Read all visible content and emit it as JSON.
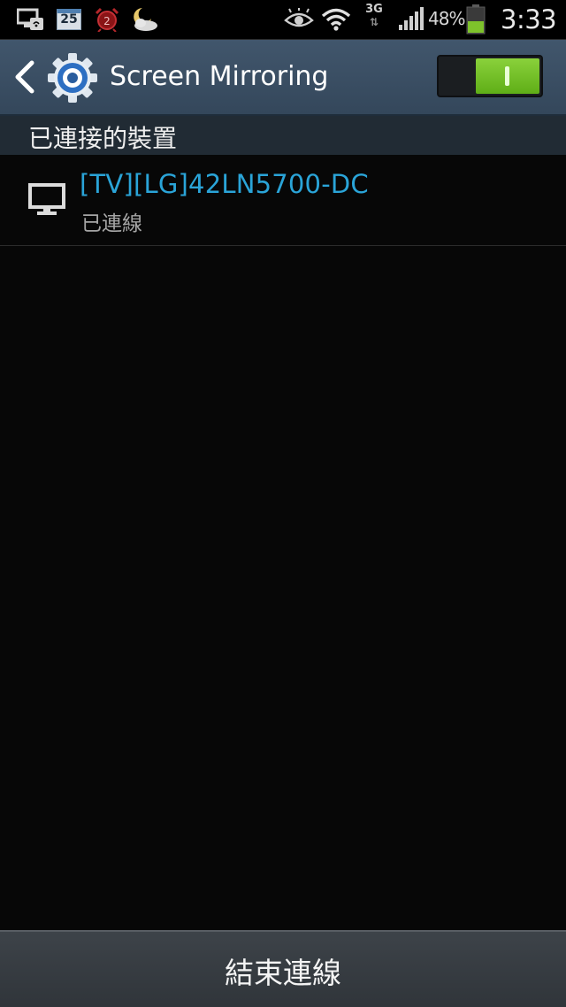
{
  "status_bar": {
    "calendar_day": "25",
    "network_type": "3G",
    "battery_percent": "48%",
    "battery_level": 0.48,
    "time": "3:33",
    "icons": [
      "screen-mirroring-notification-icon",
      "calendar-icon",
      "alarm-icon",
      "weather-icon",
      "smart-stay-eye-icon",
      "wifi-icon",
      "data-activity-icon",
      "signal-icon",
      "battery-icon"
    ]
  },
  "action_bar": {
    "title": "Screen Mirroring",
    "toggle_on": true,
    "accent_color": "#6cc024"
  },
  "section_header": {
    "label": "已連接的裝置"
  },
  "devices": [
    {
      "name": "[TV][LG]42LN5700-DC",
      "status": "已連線",
      "icon": "monitor-icon"
    }
  ],
  "bottom_button": {
    "label": "結束連線"
  },
  "colors": {
    "device_name": "#2aa4d8",
    "action_bar": "#3b4f64",
    "background": "#070707"
  }
}
